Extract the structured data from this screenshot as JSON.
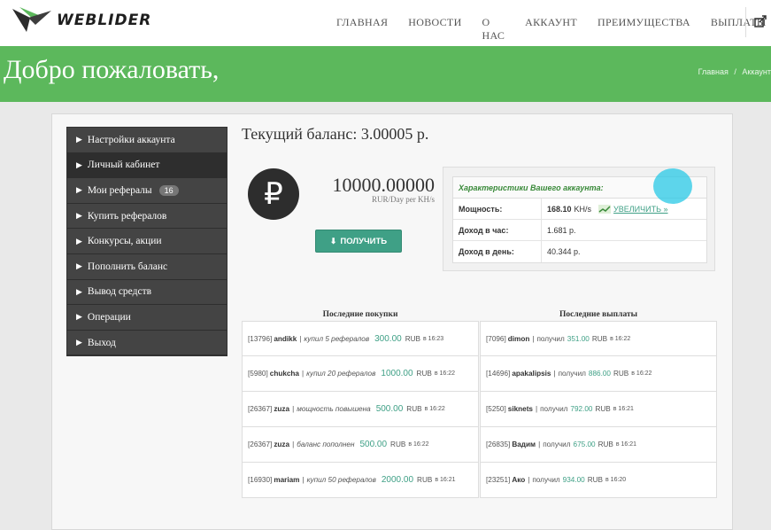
{
  "brand": {
    "name": "WEBLIDER"
  },
  "nav": [
    {
      "label": "ГЛАВНАЯ"
    },
    {
      "label": "НОВОСТИ"
    },
    {
      "label": "О НАС"
    },
    {
      "label": "АККАУНТ"
    },
    {
      "label": "ПРЕИМУЩЕСТВА"
    },
    {
      "label": "ВЫПЛАТЫ"
    }
  ],
  "banner": {
    "title": "Добро пожаловать,",
    "breadcrumb": [
      "Главная",
      "/",
      "Аккаунт"
    ]
  },
  "sidebar": {
    "items": [
      {
        "label": "Настройки аккаунта"
      },
      {
        "label": "Личный кабинет"
      },
      {
        "label": "Мои рефералы",
        "badge": "16"
      },
      {
        "label": "Купить рефералов"
      },
      {
        "label": "Конкурсы, акции"
      },
      {
        "label": "Пополнить баланс"
      },
      {
        "label": "Вывод средств"
      },
      {
        "label": "Операции"
      },
      {
        "label": "Выход"
      }
    ]
  },
  "balance": {
    "title": "Текущий баланс: 3.00005 р.",
    "currency_symbol": "₽",
    "power_value": "10000.00000",
    "power_unit": "RUR/Day per KH/s",
    "get_button": "ПОЛУЧИТЬ"
  },
  "stats": {
    "header": "Характеристики Вашего аккаунта:",
    "rows": [
      {
        "key": "Мощность:",
        "value": "168.10",
        "unit": "KH/s",
        "action": "УВЕЛИЧИТЬ »"
      },
      {
        "key": "Доход в час:",
        "value": "1.681 р."
      },
      {
        "key": "Доход в день:",
        "value": "40.344 р."
      }
    ]
  },
  "purchases": {
    "title": "Последние покупки",
    "items": [
      {
        "id": "[13796]",
        "name": "andikk",
        "action": "купил 5 рефералов",
        "amount": "300.00",
        "currency": "RUB",
        "time": "в 16:23"
      },
      {
        "id": "[5980]",
        "name": "chukcha",
        "action": "купил 20 рефералов",
        "amount": "1000.00",
        "currency": "RUB",
        "time": "в 16:22"
      },
      {
        "id": "[26367]",
        "name": "zuza",
        "action": "мощность повышена",
        "amount": "500.00",
        "currency": "RUB",
        "time": "в 16:22"
      },
      {
        "id": "[26367]",
        "name": "zuza",
        "action": "баланс пополнен",
        "amount": "500.00",
        "currency": "RUB",
        "time": "в 16:22"
      },
      {
        "id": "[16930]",
        "name": "mariam",
        "action": "купил 50 рефералов",
        "amount": "2000.00",
        "currency": "RUB",
        "time": "в 16:21"
      }
    ]
  },
  "payouts": {
    "title": "Последние выплаты",
    "items": [
      {
        "id": "[7096]",
        "name": "dimon",
        "action": "получил",
        "amount": "351.00",
        "currency": "RUB",
        "time": "в 16:22"
      },
      {
        "id": "[14696]",
        "name": "apakalipsis",
        "action": "получил",
        "amount": "886.00",
        "currency": "RUB",
        "time": "в 16:22"
      },
      {
        "id": "[5250]",
        "name": "siknets",
        "action": "получил",
        "amount": "792.00",
        "currency": "RUB",
        "time": "в 16:21"
      },
      {
        "id": "[26835]",
        "name": "Вадим",
        "action": "получил",
        "amount": "675.00",
        "currency": "RUB",
        "time": "в 16:21"
      },
      {
        "id": "[23251]",
        "name": "Ако",
        "action": "получил",
        "amount": "934.00",
        "currency": "RUB",
        "time": "в 16:20"
      }
    ]
  },
  "colors": {
    "banner": "#5cb85c",
    "accent": "#3fa086",
    "sidebar": "#444444"
  }
}
